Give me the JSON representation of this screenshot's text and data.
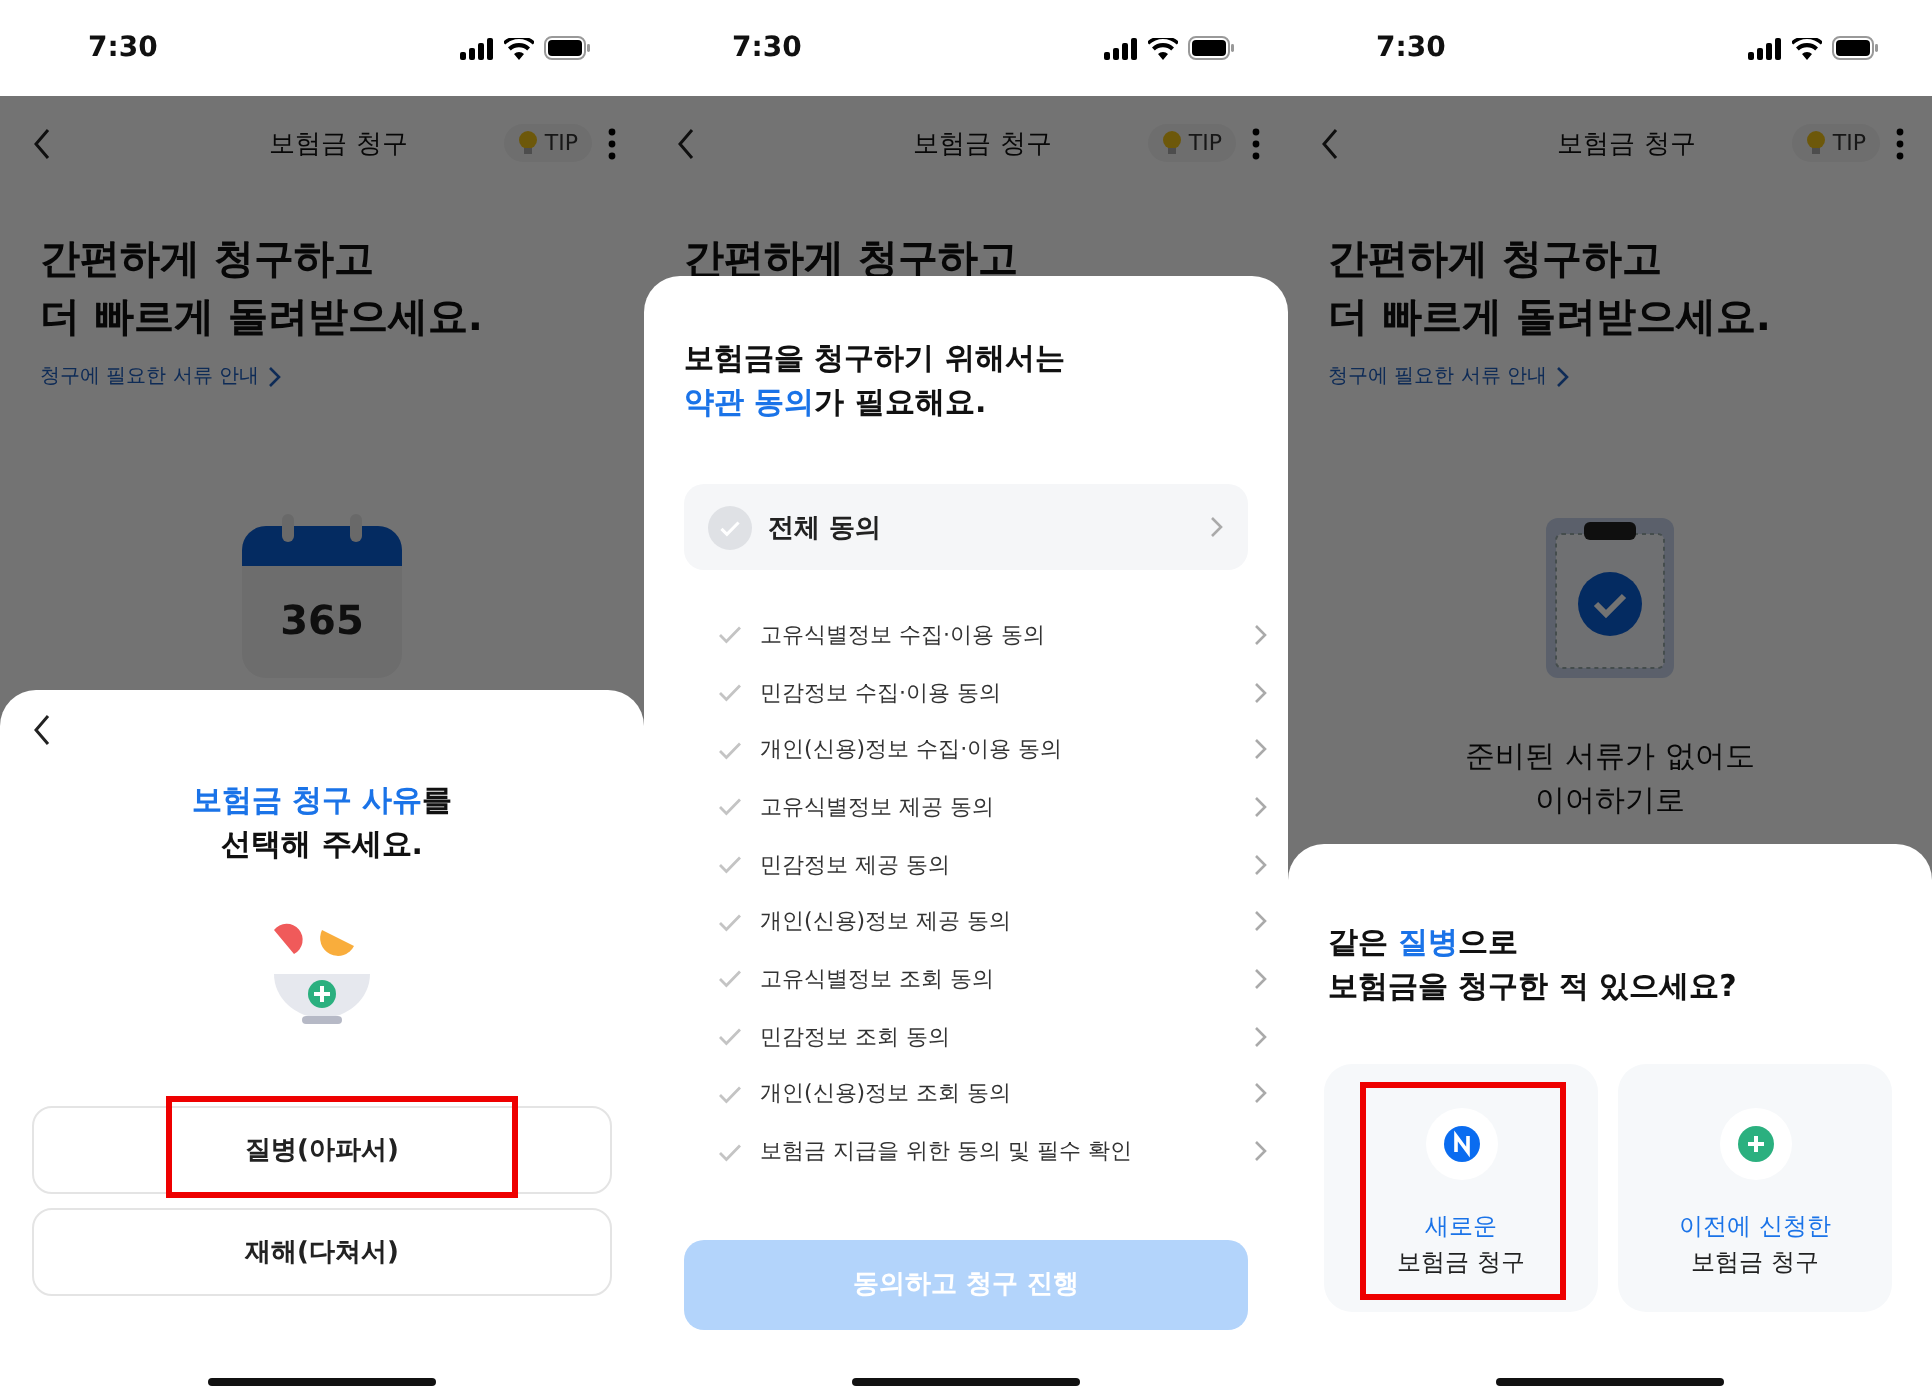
{
  "screens": [
    {
      "status_bar": {
        "time": "7:30"
      },
      "header": {
        "title": "보험금 청구",
        "tip": "TIP"
      },
      "headline": [
        "간편하게 청구하고",
        "더 빠르게 돌려받으세요."
      ],
      "guide_link": "청구에 필요한 서류 안내",
      "illustration": {
        "kind": "calendar",
        "number": "365"
      },
      "sheet": {
        "kind": "reason",
        "title": [
          [
            {
              "text": "보험금 청구 사유",
              "accent": true
            },
            {
              "text": "를",
              "accent": false
            }
          ],
          [
            {
              "text": "선택해 주세요.",
              "accent": false
            }
          ]
        ],
        "options": [
          {
            "label": "질병(아파서)",
            "highlighted": true
          },
          {
            "label": "재해(다쳐서)",
            "highlighted": false
          }
        ]
      }
    },
    {
      "status_bar": {
        "time": "7:30"
      },
      "header": {
        "title": "보험금 청구",
        "tip": "TIP"
      },
      "headline": [
        "간편하게 청구하고"
      ],
      "sheet": {
        "kind": "terms",
        "title": [
          [
            {
              "text": "보험금을 청구하기 위해서는",
              "accent": false
            }
          ],
          [
            {
              "text": "약관 동의",
              "accent": true
            },
            {
              "text": "가 필요해요.",
              "accent": false
            }
          ]
        ],
        "all_agree": {
          "label": "전체 동의",
          "checked": false
        },
        "items": [
          {
            "label": "고유식별정보 수집·이용 동의",
            "checked": false
          },
          {
            "label": "민감정보 수집·이용 동의",
            "checked": false
          },
          {
            "label": "개인(신용)정보 수집·이용 동의",
            "checked": false
          },
          {
            "label": "고유식별정보 제공 동의",
            "checked": false
          },
          {
            "label": "민감정보 제공 동의",
            "checked": false
          },
          {
            "label": "개인(신용)정보 제공 동의",
            "checked": false
          },
          {
            "label": "고유식별정보 조회 동의",
            "checked": false
          },
          {
            "label": "민감정보 조회 동의",
            "checked": false
          },
          {
            "label": "개인(신용)정보 조회 동의",
            "checked": false
          },
          {
            "label": "보험금 지급을 위한 동의 및 필수 확인",
            "checked": false
          }
        ],
        "submit": {
          "label": "동의하고 청구 진행",
          "disabled": true
        }
      }
    },
    {
      "status_bar": {
        "time": "7:30"
      },
      "header": {
        "title": "보험금 청구",
        "tip": "TIP"
      },
      "headline": [
        "간편하게 청구하고",
        "더 빠르게 돌려받으세요."
      ],
      "guide_link": "청구에 필요한 서류 안내",
      "illustration": {
        "kind": "clipboard"
      },
      "caption": [
        "준비된 서류가 없어도",
        "이어하기로"
      ],
      "sheet": {
        "kind": "history",
        "title": [
          [
            {
              "text": "같은 ",
              "accent": false
            },
            {
              "text": "질병",
              "accent": true
            },
            {
              "text": "으로",
              "accent": false
            }
          ],
          [
            {
              "text": "보험금을 청구한 적 있으세요?",
              "accent": false
            }
          ]
        ],
        "cards": [
          {
            "kind": "new",
            "accent": "새로운",
            "label": "보험금 청구",
            "highlighted": true
          },
          {
            "kind": "plus",
            "accent": "이전에 신청한",
            "label": "보험금 청구",
            "highlighted": false
          }
        ]
      }
    }
  ]
}
